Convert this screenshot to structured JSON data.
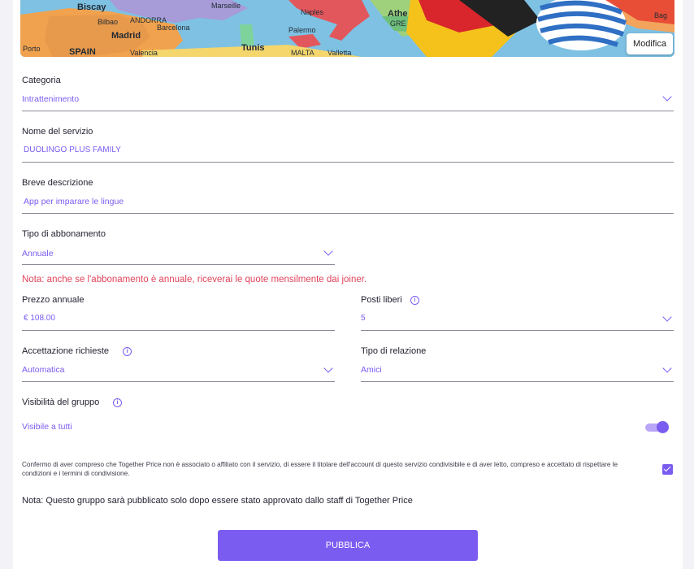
{
  "banner": {
    "edit_label": "Modifica",
    "map_labels": [
      "Biscay",
      "Bilbao",
      "ANDORRA",
      "Marseille",
      "Naples",
      "Madrid",
      "Barcelona",
      "SPAIN",
      "Valencia",
      "Palermo",
      "Tunis",
      "MALTA",
      "Valletta",
      "Porto",
      "Athe",
      "GRE",
      "Bag"
    ]
  },
  "form": {
    "categoria": {
      "label": "Categoria",
      "value": "Intrattenimento"
    },
    "nome": {
      "label": "Nome del servizio",
      "value": "DUOLINGO PLUS FAMILY"
    },
    "descrizione": {
      "label": "Breve descrizione",
      "value": "App per imparare le lingue"
    },
    "tipo_abbonamento": {
      "label": "Tipo di abbonamento",
      "value": "Annuale"
    },
    "nota_annuale": "Nota: anche se l'abbonamento è annuale, riceverai le quote mensilmente dai joiner.",
    "prezzo": {
      "label": "Prezzo annuale",
      "value": "€ 108.00"
    },
    "posti": {
      "label": "Posti liberi",
      "value": "5"
    },
    "accettazione": {
      "label": "Accettazione richieste",
      "value": "Automatica"
    },
    "relazione": {
      "label": "Tipo di relazione",
      "value": "Amici"
    },
    "visibilita": {
      "label": "Visibilità del gruppo",
      "value": "Visibile a tutti",
      "enabled": true
    },
    "conferma_text": "Confermo di aver compreso che Together Price non è associato o affiliato con il servizio, di essere il titolare dell'account di questo servizio condivisibile e di aver letto, compreso e accettato di rispettare le condizioni e i termini di condivisione.",
    "conferma_checked": true,
    "nota_approvazione": "Nota: Questo gruppo sarà pubblicato solo dopo essere stato approvato dallo staff di Together Price",
    "publish_label": "PUBBLICA"
  },
  "icons": {
    "info": "info-icon",
    "chevron": "chevron-down-icon",
    "check": "check-icon"
  },
  "colors": {
    "accent": "#7b5cf0",
    "warning": "#e2445c",
    "toggle_track": "#b9a6f7"
  }
}
